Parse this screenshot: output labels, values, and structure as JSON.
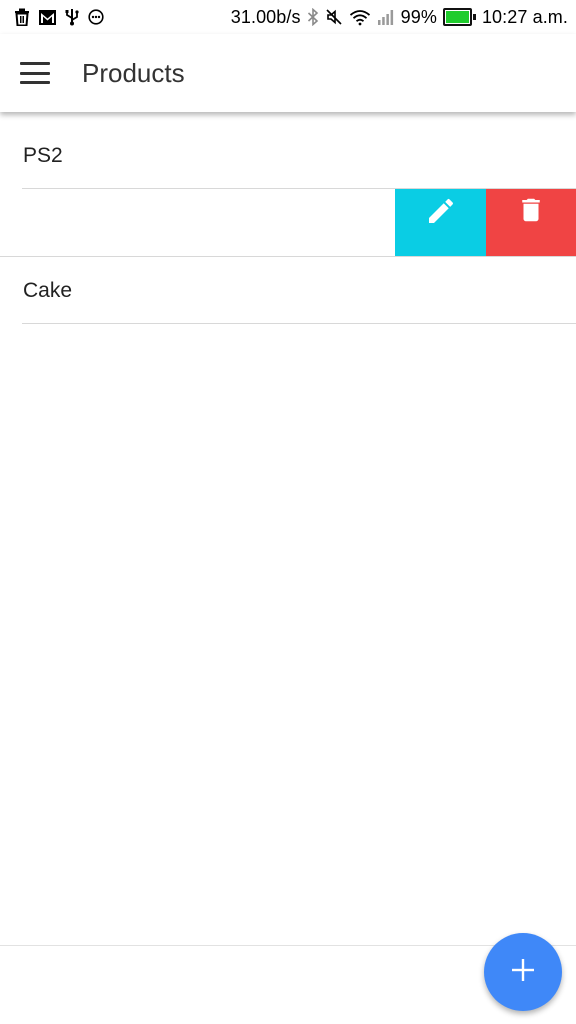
{
  "status_bar": {
    "net_speed": "31.00b/s",
    "battery_percent": "99%",
    "battery_level": 0.99,
    "time": "10:27 a.m.",
    "left_icons": [
      "trash-icon",
      "gmail-icon",
      "usb-icon",
      "more-circle-icon"
    ],
    "right_icons": [
      "bluetooth-icon",
      "mute-icon",
      "wifi-icon",
      "signal-icon"
    ]
  },
  "app_bar": {
    "title": "Products",
    "menu_icon": "hamburger-menu-icon"
  },
  "products": [
    {
      "label": "PS2"
    },
    {
      "label": ""
    },
    {
      "label": "Cake"
    }
  ],
  "swipe_actions": {
    "edit_icon": "pencil-icon",
    "delete_icon": "trash-icon",
    "edit_color": "#0acde4",
    "delete_color": "#f04444"
  },
  "fab": {
    "icon": "plus-icon",
    "color": "#3f88f8"
  }
}
